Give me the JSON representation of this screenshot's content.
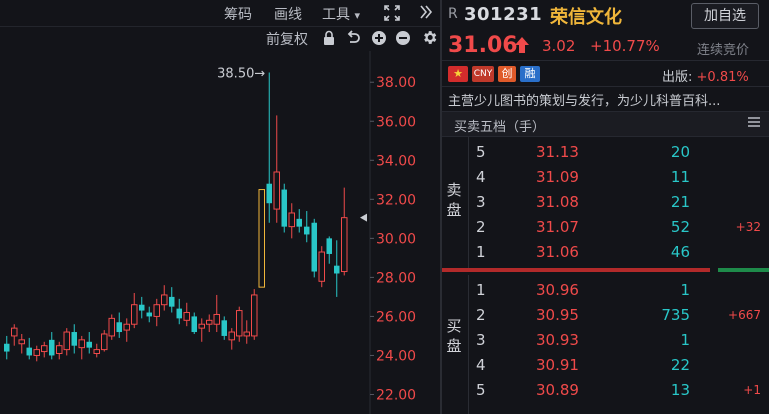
{
  "toolbar": {
    "chips_label": "筹码",
    "draw_label": "画线",
    "tools_label": "工具",
    "tools_caret": "▾",
    "fullscreen_icon": "expand-icon",
    "collapse_icon": "double-chevron-right-icon",
    "adjust_label": "前复权"
  },
  "toolbar_icons": [
    "lock-icon",
    "undo-icon",
    "zoom-in-icon",
    "zoom-out-icon",
    "gear-icon"
  ],
  "chart_data": {
    "type": "candlestick",
    "ylim": [
      21,
      39.6
    ],
    "yticks": [
      "38.00",
      "36.00",
      "34.00",
      "32.00",
      "30.00",
      "28.00",
      "26.00",
      "24.00",
      "22.00"
    ],
    "high_marker": "38.50→",
    "colors": {
      "up": "#f04a4a",
      "down": "#29c7c8",
      "highlight": "#f0b63a"
    },
    "candles": [
      {
        "o": 24.6,
        "h": 25.0,
        "l": 23.8,
        "c": 24.2
      },
      {
        "o": 25.0,
        "h": 25.6,
        "l": 24.5,
        "c": 25.4
      },
      {
        "o": 24.6,
        "h": 25.1,
        "l": 24.1,
        "c": 24.8
      },
      {
        "o": 24.4,
        "h": 24.9,
        "l": 23.8,
        "c": 24.0
      },
      {
        "o": 24.0,
        "h": 24.5,
        "l": 23.7,
        "c": 24.3
      },
      {
        "o": 24.2,
        "h": 24.7,
        "l": 23.9,
        "c": 24.5
      },
      {
        "o": 24.8,
        "h": 25.2,
        "l": 23.8,
        "c": 24.0
      },
      {
        "o": 24.1,
        "h": 24.7,
        "l": 23.8,
        "c": 24.5
      },
      {
        "o": 24.3,
        "h": 25.4,
        "l": 24.0,
        "c": 25.2
      },
      {
        "o": 25.2,
        "h": 25.6,
        "l": 24.1,
        "c": 24.5
      },
      {
        "o": 24.4,
        "h": 25.0,
        "l": 23.8,
        "c": 24.8
      },
      {
        "o": 24.7,
        "h": 25.2,
        "l": 24.1,
        "c": 24.4
      },
      {
        "o": 24.1,
        "h": 24.6,
        "l": 23.9,
        "c": 24.3
      },
      {
        "o": 24.3,
        "h": 25.3,
        "l": 24.2,
        "c": 25.1
      },
      {
        "o": 25.0,
        "h": 26.1,
        "l": 24.8,
        "c": 25.9
      },
      {
        "o": 25.7,
        "h": 26.2,
        "l": 24.9,
        "c": 25.2
      },
      {
        "o": 25.3,
        "h": 25.9,
        "l": 24.7,
        "c": 25.6
      },
      {
        "o": 25.6,
        "h": 27.2,
        "l": 25.4,
        "c": 26.6
      },
      {
        "o": 26.6,
        "h": 27.0,
        "l": 25.9,
        "c": 26.3
      },
      {
        "o": 26.2,
        "h": 26.5,
        "l": 25.7,
        "c": 26.0
      },
      {
        "o": 26.0,
        "h": 26.9,
        "l": 25.5,
        "c": 26.6
      },
      {
        "o": 26.6,
        "h": 27.6,
        "l": 26.3,
        "c": 27.1
      },
      {
        "o": 27.0,
        "h": 27.5,
        "l": 26.2,
        "c": 26.5
      },
      {
        "o": 26.4,
        "h": 26.9,
        "l": 25.6,
        "c": 25.9
      },
      {
        "o": 25.8,
        "h": 26.7,
        "l": 25.5,
        "c": 26.2
      },
      {
        "o": 26.0,
        "h": 26.2,
        "l": 25.1,
        "c": 25.2
      },
      {
        "o": 25.4,
        "h": 25.9,
        "l": 24.7,
        "c": 25.6
      },
      {
        "o": 25.6,
        "h": 26.1,
        "l": 25.2,
        "c": 25.8
      },
      {
        "o": 25.6,
        "h": 27.1,
        "l": 25.2,
        "c": 26.1
      },
      {
        "o": 25.8,
        "h": 26.0,
        "l": 24.8,
        "c": 25.0
      },
      {
        "o": 24.8,
        "h": 25.4,
        "l": 24.3,
        "c": 25.2
      },
      {
        "o": 25.0,
        "h": 26.5,
        "l": 24.7,
        "c": 26.3
      },
      {
        "o": 25.0,
        "h": 25.8,
        "l": 24.6,
        "c": 25.2
      },
      {
        "o": 25.0,
        "h": 27.4,
        "l": 24.8,
        "c": 27.1
      },
      {
        "o": 27.5,
        "h": 32.5,
        "l": 27.5,
        "c": 32.5,
        "limit": true
      },
      {
        "o": 32.8,
        "h": 38.5,
        "l": 30.8,
        "c": 31.8
      },
      {
        "o": 31.5,
        "h": 36.3,
        "l": 30.8,
        "c": 33.4
      },
      {
        "o": 32.5,
        "h": 32.8,
        "l": 30.3,
        "c": 30.6
      },
      {
        "o": 30.6,
        "h": 31.8,
        "l": 30.0,
        "c": 31.3
      },
      {
        "o": 31.0,
        "h": 31.5,
        "l": 30.3,
        "c": 30.6
      },
      {
        "o": 30.6,
        "h": 31.4,
        "l": 29.8,
        "c": 30.2
      },
      {
        "o": 30.8,
        "h": 31.0,
        "l": 28.0,
        "c": 28.3
      },
      {
        "o": 27.8,
        "h": 29.6,
        "l": 27.5,
        "c": 29.3
      },
      {
        "o": 30.0,
        "h": 30.1,
        "l": 28.7,
        "c": 29.2
      },
      {
        "o": 28.6,
        "h": 29.9,
        "l": 27.0,
        "c": 28.2
      },
      {
        "o": 28.3,
        "h": 32.6,
        "l": 28.1,
        "c": 31.06
      }
    ]
  },
  "stock": {
    "r_badge": "R",
    "code": "301231",
    "name": "荣信文化",
    "add_label": "加自选",
    "price": "31.06",
    "arrow": "🠉",
    "change": "3.02",
    "change_pct": "+10.77%",
    "auction": "连续竞价",
    "tags": {
      "flag": "★",
      "cny": "CNY",
      "chuang": "创",
      "rong": "融"
    },
    "sector_label": "出版:",
    "sector_pct": "+0.81%",
    "description": "主营少儿图书的策划与发行，为少儿科普百科..."
  },
  "orderbook": {
    "title": "买卖五档（手）",
    "sell_label": "卖盘",
    "buy_label": "买盘",
    "sell": [
      {
        "level": "5",
        "price": "31.13",
        "volume": "20",
        "change": ""
      },
      {
        "level": "4",
        "price": "31.09",
        "volume": "11",
        "change": ""
      },
      {
        "level": "3",
        "price": "31.08",
        "volume": "21",
        "change": ""
      },
      {
        "level": "2",
        "price": "31.07",
        "volume": "52",
        "change": "+32"
      },
      {
        "level": "1",
        "price": "31.06",
        "volume": "46",
        "change": ""
      }
    ],
    "buy": [
      {
        "level": "1",
        "price": "30.96",
        "volume": "1",
        "change": ""
      },
      {
        "level": "2",
        "price": "30.95",
        "volume": "735",
        "change": "+667"
      },
      {
        "level": "3",
        "price": "30.93",
        "volume": "1",
        "change": ""
      },
      {
        "level": "4",
        "price": "30.91",
        "volume": "22",
        "change": ""
      },
      {
        "level": "5",
        "price": "30.89",
        "volume": "13",
        "change": "+1"
      }
    ]
  }
}
